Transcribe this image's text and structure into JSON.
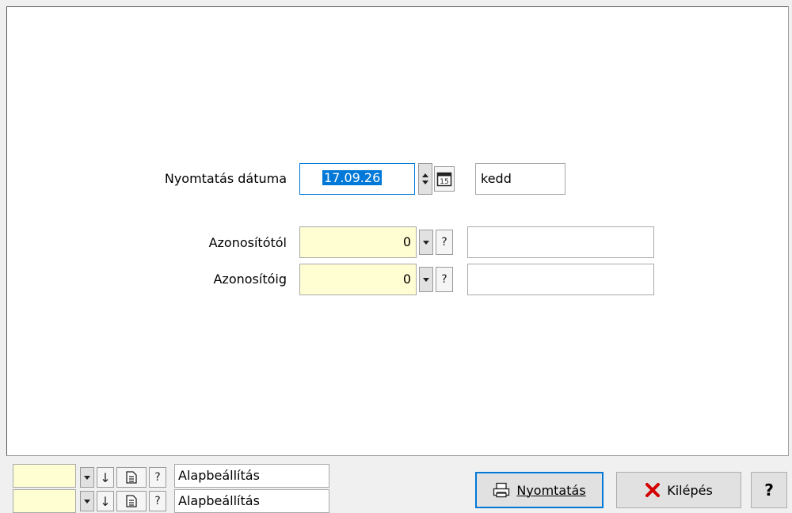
{
  "form": {
    "print_date_label": "Nyomtatás dátuma",
    "print_date_value": "17.09.26",
    "calendar_icon_text": "15",
    "weekday_value": "kedd",
    "from_id_label": "Azonosítótól",
    "from_id_value": "0",
    "from_id_help": "?",
    "from_id_name": "",
    "to_id_label": "Azonosítóig",
    "to_id_value": "0",
    "to_id_help": "?",
    "to_id_name": ""
  },
  "footer": {
    "presets": [
      {
        "code": "",
        "help": "?",
        "name": "Alapbeállítás"
      },
      {
        "code": "",
        "help": "?",
        "name": "Alapbeállítás"
      }
    ],
    "print_button_label": "Nyomtatás",
    "exit_button_label": "Kilépés",
    "help_button_label": "?"
  },
  "colors": {
    "input_yellow": "#fffdd2",
    "selection_blue": "#0078d7",
    "exit_red": "#d40000"
  }
}
